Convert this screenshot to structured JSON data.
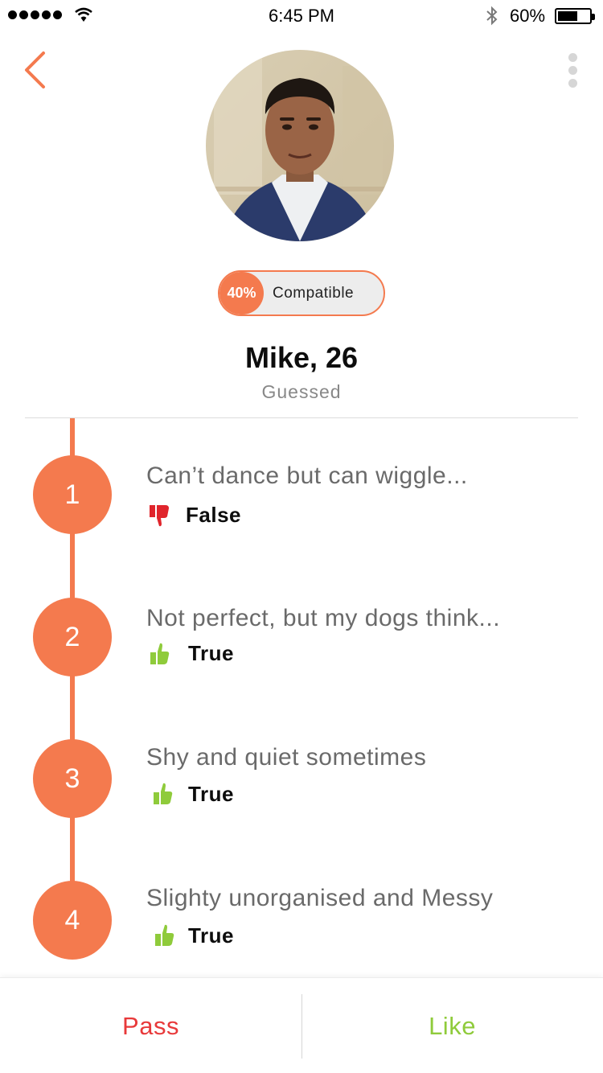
{
  "status_bar": {
    "time": "6:45 PM",
    "battery": "60%",
    "battery_level": 0.6,
    "icons": [
      "signal-dots-icon",
      "wifi-icon",
      "bluetooth-icon",
      "battery-icon"
    ]
  },
  "header": {
    "back_icon": "chevron-left-icon",
    "more_icon": "more-vertical-icon"
  },
  "profile": {
    "compat_percent": "40%",
    "compat_label": "Compatible",
    "name": "Mike, 26",
    "subtitle": "Guessed"
  },
  "items": [
    {
      "number": "1",
      "title": "Can’t dance but can wiggle...",
      "answer": "False",
      "icon": "thumbs-down-icon"
    },
    {
      "number": "2",
      "title": "Not perfect, but my dogs think...",
      "answer": "True",
      "icon": "thumbs-up-icon"
    },
    {
      "number": "3",
      "title": "Shy and quiet sometimes",
      "answer": "True",
      "icon": "thumbs-up-icon"
    },
    {
      "number": "4",
      "title": "Slighty unorganised and Messy",
      "answer": "True",
      "icon": "thumbs-up-icon"
    }
  ],
  "actions": {
    "pass": "Pass",
    "like": "Like"
  },
  "colors": {
    "accent": "#f47a4e",
    "pass": "#e8393a",
    "like": "#8fcb3b",
    "thumb_down": "#e0252c",
    "thumb_up": "#8fcb3b"
  }
}
